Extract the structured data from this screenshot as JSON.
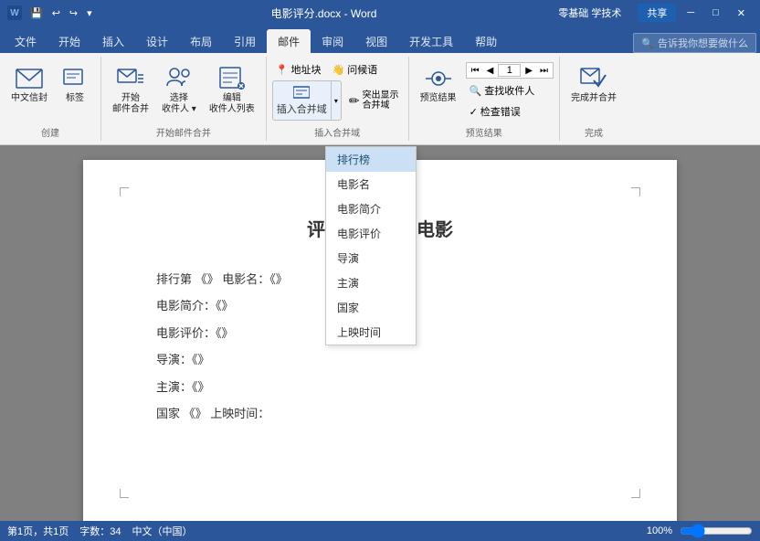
{
  "titlebar": {
    "filename": "电影评分.docx - Word",
    "app": "Word",
    "undo": "↩",
    "redo": "↪",
    "save": "💾",
    "customize": "▾",
    "minimize": "─",
    "restore": "□",
    "close": "✕",
    "topright": "零基础 学技术",
    "share": "共享"
  },
  "tabs": [
    {
      "label": "文件",
      "active": false
    },
    {
      "label": "开始",
      "active": false
    },
    {
      "label": "插入",
      "active": false
    },
    {
      "label": "设计",
      "active": false
    },
    {
      "label": "布局",
      "active": false
    },
    {
      "label": "引用",
      "active": false
    },
    {
      "label": "邮件",
      "active": true
    },
    {
      "label": "审阅",
      "active": false
    },
    {
      "label": "视图",
      "active": false
    },
    {
      "label": "开发工具",
      "active": false
    },
    {
      "label": "帮助",
      "active": false
    }
  ],
  "ribbon": {
    "groups": [
      {
        "name": "创建",
        "items": [
          {
            "type": "big",
            "label": "中文信封",
            "icon": "✉"
          },
          {
            "type": "big",
            "label": "标签",
            "icon": "🏷"
          }
        ]
      },
      {
        "name": "开始邮件合并",
        "items": [
          {
            "type": "big",
            "label": "开始\n邮件合并",
            "icon": "✉"
          },
          {
            "type": "big",
            "label": "选择\n收件人▾",
            "icon": "👥"
          },
          {
            "type": "big",
            "label": "编辑\n收件人列表",
            "icon": "📋"
          }
        ]
      },
      {
        "name": "插入合并域",
        "items": [
          {
            "type": "small",
            "label": "地址块",
            "icon": "📍"
          },
          {
            "type": "small",
            "label": "问候语",
            "icon": "👋"
          },
          {
            "type": "big-split",
            "label": "插入合并域▾",
            "icon": "≡"
          },
          {
            "type": "small",
            "label": "突出显示\n合并域",
            "icon": "✏"
          }
        ]
      },
      {
        "name": "预览结果",
        "items": [
          {
            "type": "big",
            "label": "预览结果",
            "icon": "👁"
          },
          {
            "type": "small",
            "label": "查找收件人",
            "icon": "🔍"
          },
          {
            "type": "small",
            "label": "检查错误",
            "icon": "✓"
          },
          {
            "type": "nav",
            "value": "1"
          }
        ]
      },
      {
        "name": "完成",
        "items": [
          {
            "type": "big",
            "label": "完成并合并",
            "icon": "✔"
          }
        ]
      }
    ]
  },
  "dropdown": {
    "items": [
      {
        "label": "排行榜",
        "highlighted": true
      },
      {
        "label": "电影名",
        "highlighted": false
      },
      {
        "label": "电影简介",
        "highlighted": false
      },
      {
        "label": "电影评价",
        "highlighted": false
      },
      {
        "label": "导演",
        "highlighted": false
      },
      {
        "label": "主演",
        "highlighted": false
      },
      {
        "label": "国家",
        "highlighted": false
      },
      {
        "label": "上映时间",
        "highlighted": false
      }
    ]
  },
  "document": {
    "title": "评价最好的部电影",
    "lines": [
      "排行第 《》 电影名：《》",
      "电影简介：《》",
      "电影评价：《》",
      "导演：《》",
      "主演：《》",
      "国家 《》 上映时间："
    ]
  },
  "statusbar": {
    "page": "第1页，共1页",
    "words": "字数：34",
    "lang": "中文（中国）",
    "zoom": "100%"
  },
  "searchbar": {
    "placeholder": "告诉我你想要做什么"
  }
}
